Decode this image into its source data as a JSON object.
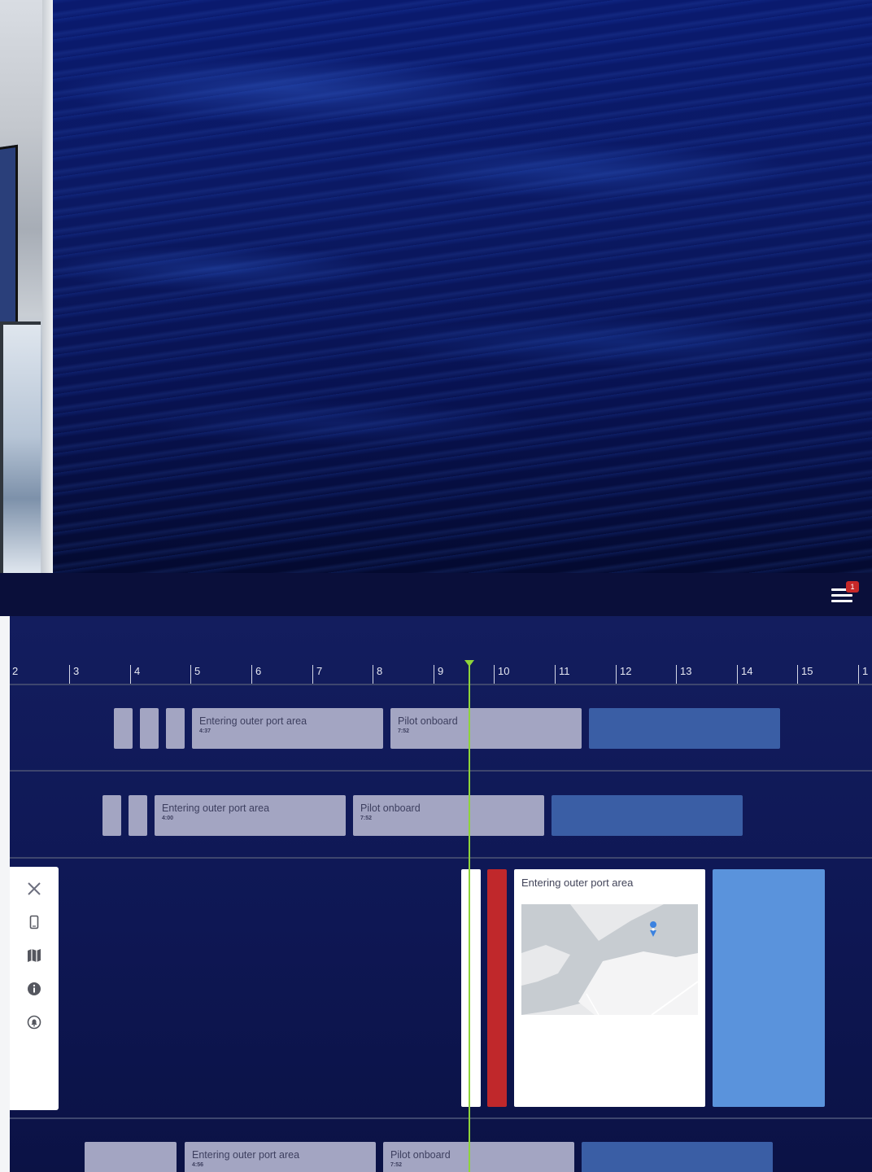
{
  "header": {
    "menu_badge": "1"
  },
  "timeline": {
    "ticks": [
      "2",
      "3",
      "4",
      "5",
      "6",
      "7",
      "8",
      "9",
      "10",
      "11",
      "12",
      "13",
      "14",
      "15",
      "1"
    ],
    "rows": [
      {
        "events": [
          {
            "label": "Entering outer port area",
            "time": "4:37"
          },
          {
            "label": "Pilot onboard",
            "time": "7:52"
          }
        ]
      },
      {
        "events": [
          {
            "label": "Entering outer port area",
            "time": "4:00"
          },
          {
            "label": "Pilot onboard",
            "time": "7:52"
          }
        ]
      },
      {
        "expanded": true,
        "card": {
          "label": "Entering outer port area"
        }
      },
      {
        "events": [
          {
            "label": "Entering outer port area",
            "time": "4:56"
          },
          {
            "label": "Pilot onboard",
            "time": "7:52"
          }
        ]
      }
    ]
  },
  "side_panel": {
    "icons": [
      "close-icon",
      "phone-icon",
      "map-icon",
      "info-icon",
      "alarm-icon"
    ]
  },
  "colors": {
    "app_bar": "#0a0f3a",
    "timeline_bg": "#131d5e",
    "event_grey": "#a3a5c2",
    "event_blue": "#3a5ea5",
    "event_light_blue": "#5a93dc",
    "now_line": "#8ed43a",
    "alert_red": "#c0282b",
    "badge_red": "#c62828"
  }
}
